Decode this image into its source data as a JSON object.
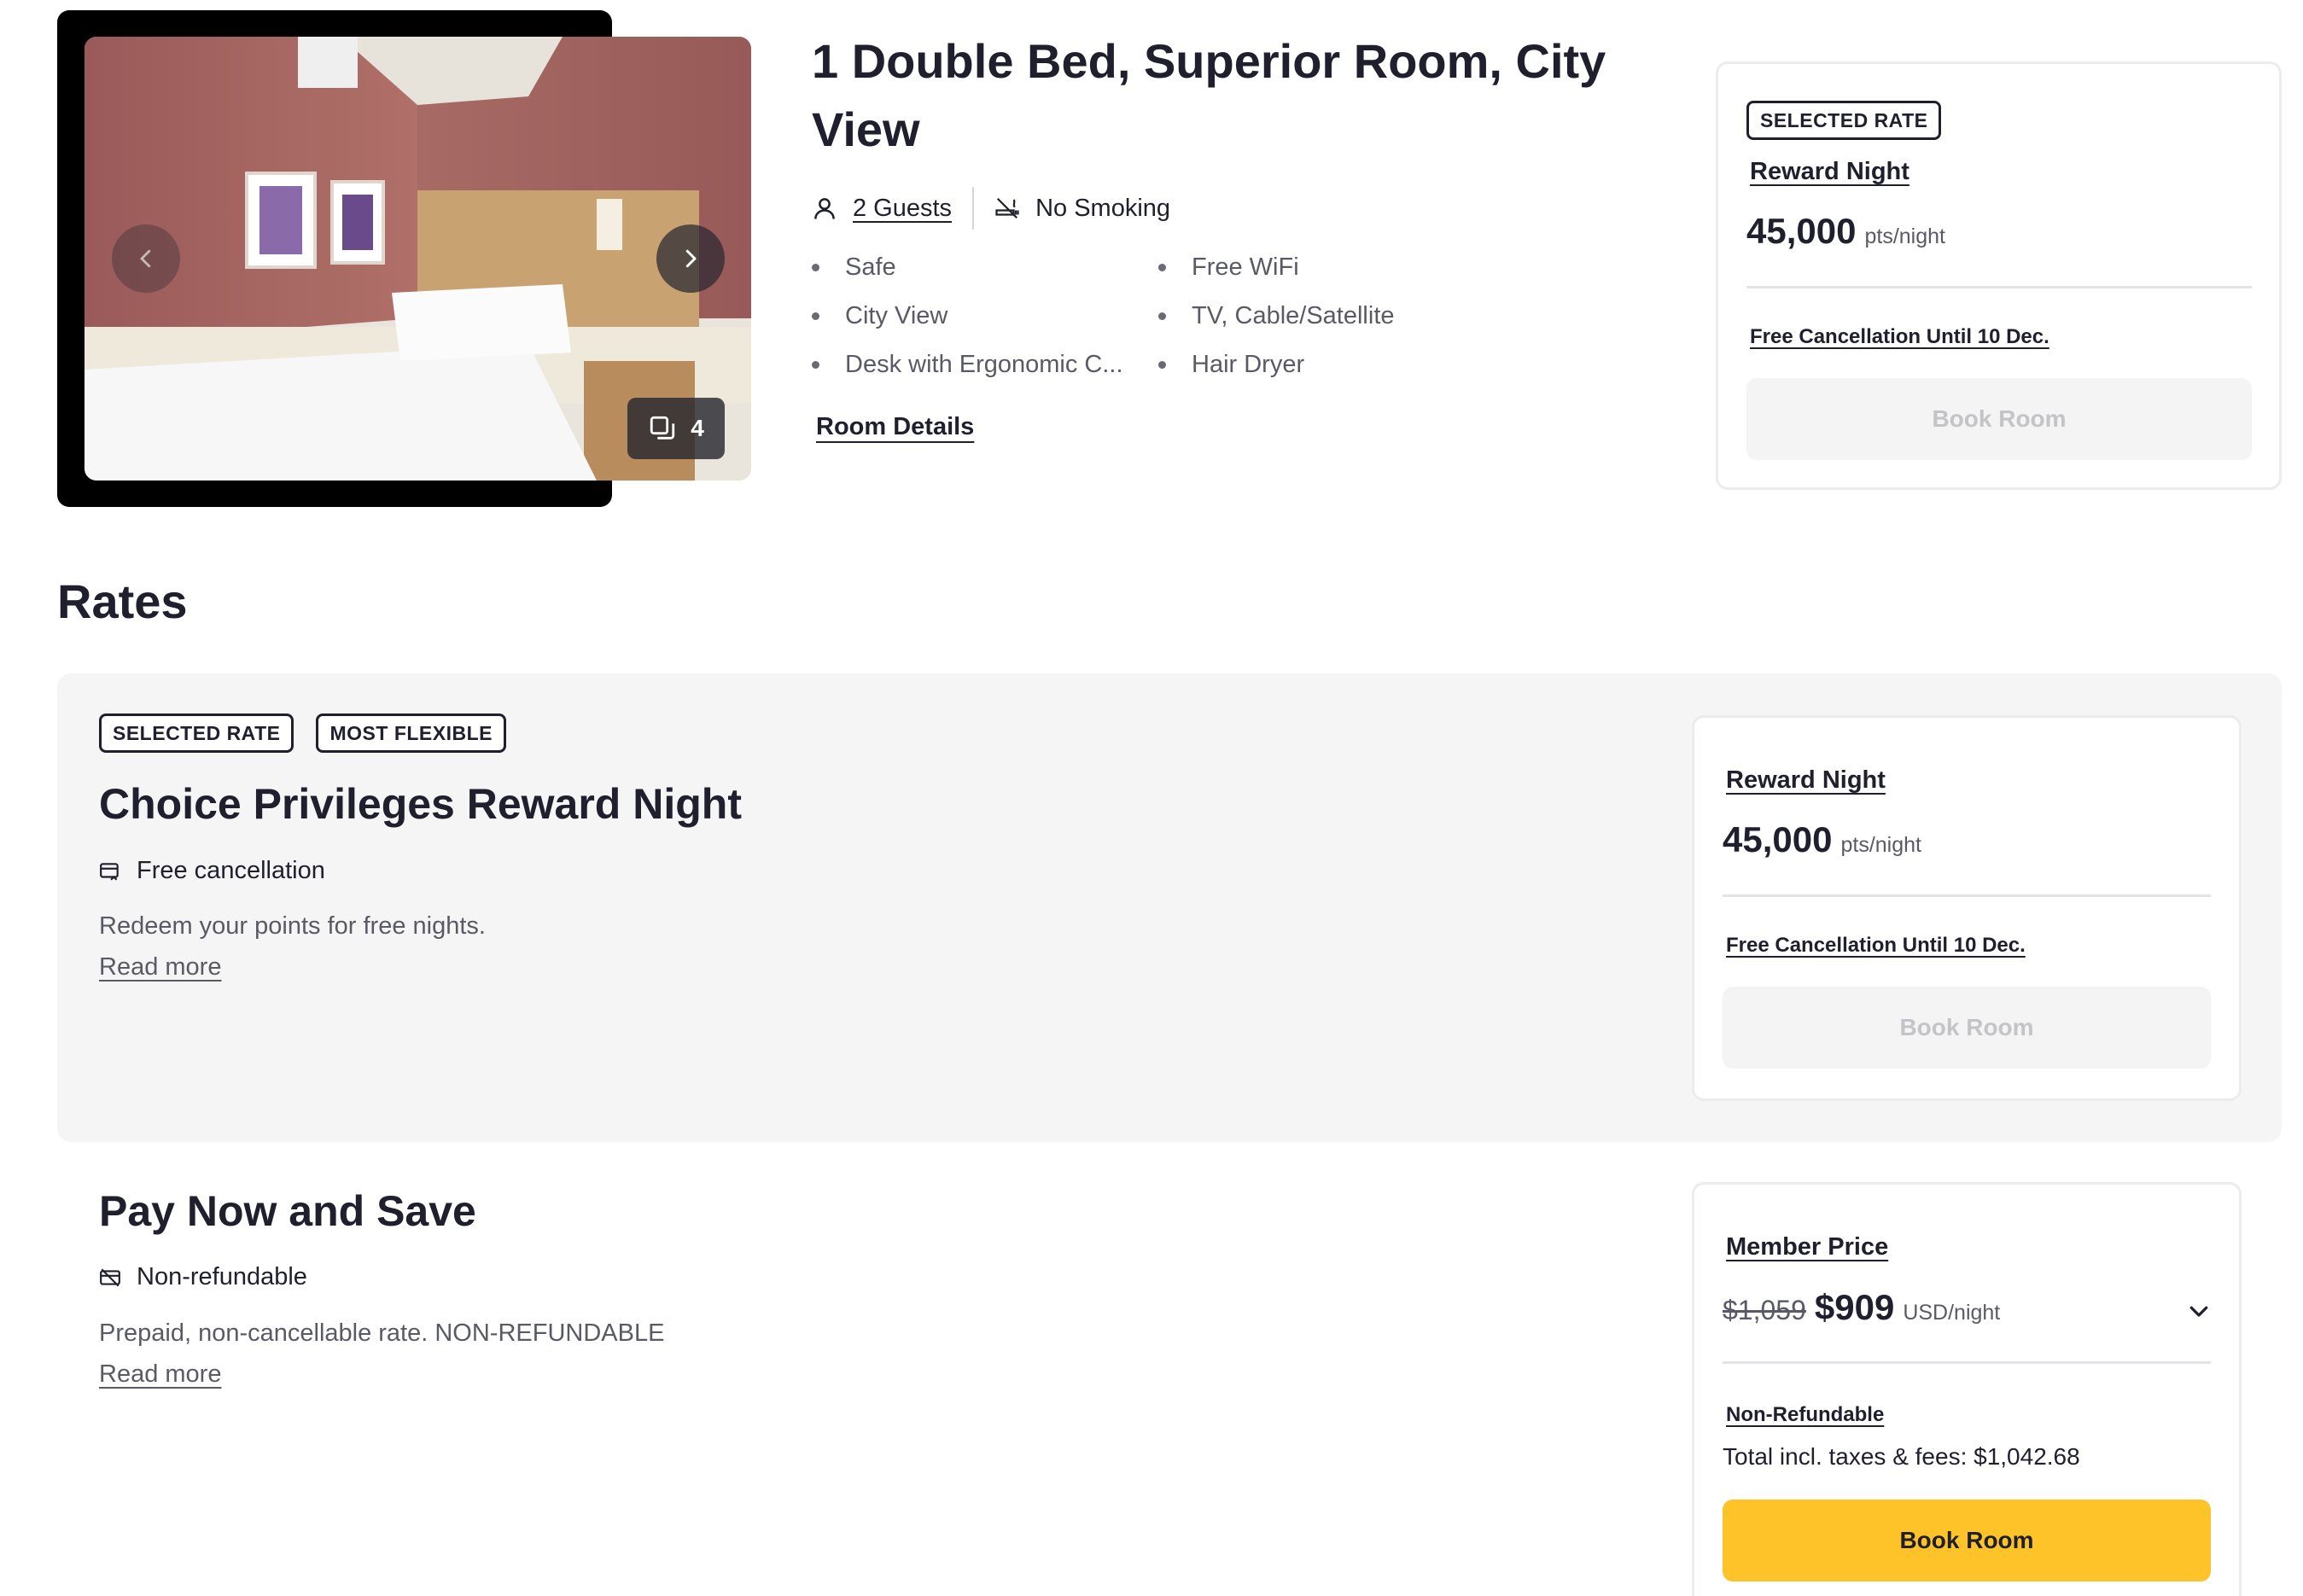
{
  "room": {
    "title": "1 Double Bed, Superior Room, City View",
    "guests": "2 Guests",
    "smoking": "No Smoking",
    "photo_count": "4",
    "amenities": [
      "Safe",
      "Free WiFi",
      "City View",
      "TV, Cable/Satellite",
      "Desk with Ergonomic C...",
      "Hair Dryer"
    ],
    "details_link": "Room Details"
  },
  "selected_card": {
    "badge": "SELECTED RATE",
    "rate_label": "Reward Night",
    "points": "45,000",
    "unit": "pts/night",
    "cancel": "Free Cancellation Until 10 Dec.",
    "book": "Book Room"
  },
  "rates_heading": "Rates",
  "rates": [
    {
      "badges": [
        "SELECTED RATE",
        "MOST FLEXIBLE"
      ],
      "name": "Choice Privileges Reward Night",
      "feature": "Free cancellation",
      "description": "Redeem your points for free nights.",
      "read_more": "Read more",
      "card": {
        "rate_label": "Reward Night",
        "points": "45,000",
        "unit": "pts/night",
        "cancel": "Free Cancellation Until 10 Dec.",
        "book": "Book Room"
      }
    },
    {
      "name": "Pay Now and Save",
      "feature": "Non-refundable",
      "description": "Prepaid, non-cancellable rate. NON-REFUNDABLE",
      "read_more": "Read more",
      "card": {
        "rate_label": "Member Price",
        "old_price": "$1,059",
        "price": "$909",
        "unit": "USD/night",
        "cancel": "Non-Refundable",
        "total": "Total incl. taxes & fees: $1,042.68",
        "book": "Book Room"
      }
    }
  ],
  "colors": {
    "text": "#1f1f2e",
    "muted": "#5a5a66",
    "accent_button": "#ffc32a",
    "rate_bg": "#f5f5f5"
  },
  "icons": [
    "chevron-left-icon",
    "chevron-right-icon",
    "gallery-icon",
    "person-icon",
    "no-smoking-icon",
    "free-cancellation-icon",
    "non-refundable-icon",
    "chevron-down-icon"
  ]
}
